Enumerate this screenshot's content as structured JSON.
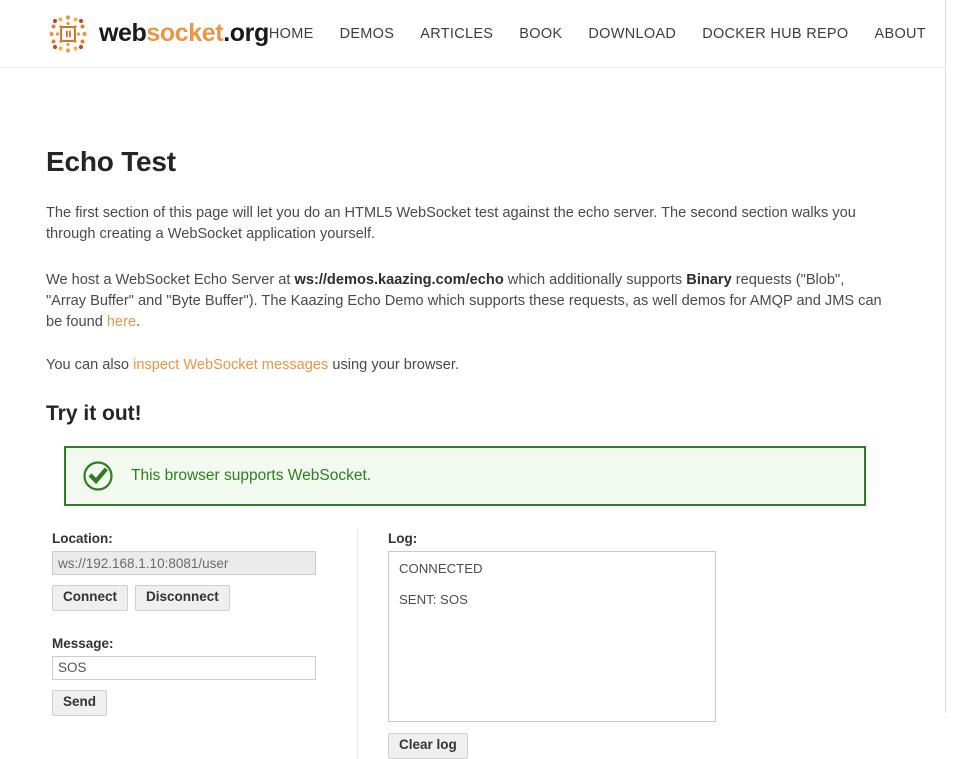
{
  "header": {
    "logo": {
      "icon": "websocket-chip-logo",
      "part1": "web",
      "part2": "socket",
      "part3": ".org"
    },
    "nav": [
      {
        "label": "HOME",
        "name": "nav-home"
      },
      {
        "label": "DEMOS",
        "name": "nav-demos"
      },
      {
        "label": "ARTICLES",
        "name": "nav-articles"
      },
      {
        "label": "BOOK",
        "name": "nav-book"
      },
      {
        "label": "DOWNLOAD",
        "name": "nav-download"
      },
      {
        "label": "DOCKER HUB REPO",
        "name": "nav-docker-hub-repo"
      },
      {
        "label": "ABOUT",
        "name": "nav-about"
      }
    ]
  },
  "main": {
    "title": "Echo Test",
    "paragraph1": "The first section of this page will let you do an HTML5 WebSocket test against the echo server. The second section walks you through creating a WebSocket application yourself.",
    "paragraph2": {
      "part1": "We host a WebSocket Echo Server at ",
      "server_url": "ws://demos.kaazing.com/echo",
      "part2": " which additionally supports ",
      "binary": "Binary",
      "part3": " requests (\"Blob\", \"Array Buffer\" and \"Byte Buffer\"). The Kaazing Echo Demo which supports these requests, as well demos for AMQP and JMS can be found ",
      "link_here": "here",
      "part4": "."
    },
    "paragraph3": {
      "part1": "You can also ",
      "link_inspect": "inspect WebSocket messages",
      "part2": " using your browser."
    },
    "section_title": "Try it out!",
    "alert": {
      "icon": "check-circle-icon",
      "text": "This browser supports WebSocket.",
      "border_color": "#2f7d22",
      "background_color": "#f2faf0",
      "text_color": "#2f7d22"
    }
  },
  "form": {
    "location": {
      "label": "Location:",
      "value": "ws://192.168.1.10:8081/user",
      "placeholder": "ws://",
      "disabled": true
    },
    "connect_button": "Connect",
    "disconnect_button": "Disconnect",
    "message": {
      "label": "Message:",
      "value": "SOS",
      "placeholder": ""
    },
    "send_button": "Send"
  },
  "log": {
    "label": "Log:",
    "entries": [
      "CONNECTED",
      "SENT: SOS"
    ],
    "clear_button": "Clear log"
  },
  "colors": {
    "accent_orange": "#e8964a",
    "success_green": "#2f7d22",
    "text": "#4a4a4a"
  }
}
